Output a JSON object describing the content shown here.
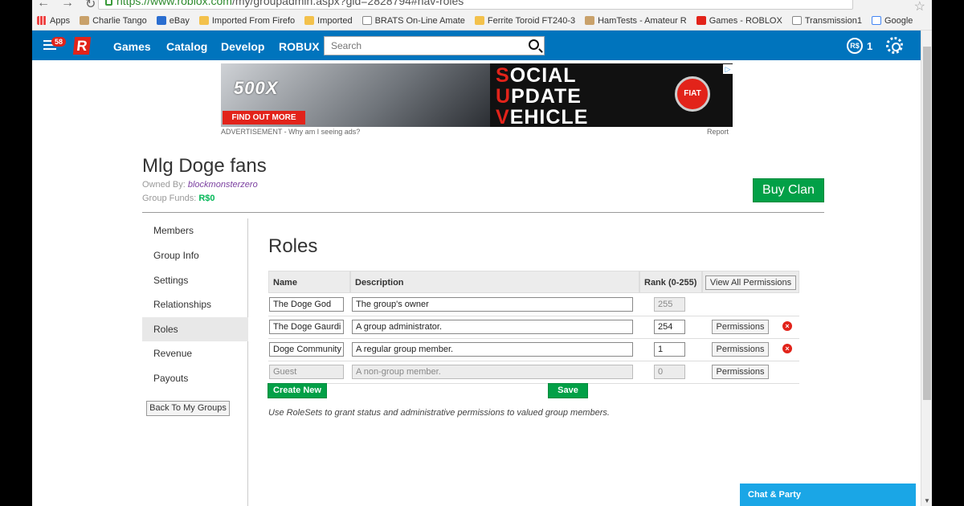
{
  "browser": {
    "url_host": "https://www.roblox.com",
    "url_path": "/my/groupadmin.aspx?gid=2828794#nav-roles",
    "bookmarks": [
      "Apps",
      "Charlie Tango",
      "eBay",
      "Imported From Firefo",
      "Imported",
      "BRATS On-Line Amate",
      "Ferrite Toroid FT240-3",
      "HamTests - Amateur R",
      "Games - ROBLOX",
      "Transmission1",
      "Google"
    ]
  },
  "navbar": {
    "notification_count": "58",
    "logo": "R",
    "links": [
      "Games",
      "Catalog",
      "Develop",
      "ROBUX"
    ],
    "search_placeholder": "Search",
    "robux_symbol": "R$",
    "robux_count": "1"
  },
  "ad": {
    "car_logo": "500X",
    "cta": "FIND OUT MORE",
    "headline_lines": [
      {
        "first": "S",
        "rest": "OCIAL"
      },
      {
        "first": "U",
        "rest": "PDATE"
      },
      {
        "first": "V",
        "rest": "EHICLE"
      }
    ],
    "brand": "FIAT",
    "caption": "ADVERTISEMENT - Why am I seeing ads?",
    "report": "Report"
  },
  "group": {
    "name": "Mlg Doge fans",
    "owned_by_label": "Owned By:",
    "owner": "blockmonsterzero",
    "funds_label": "Group Funds:",
    "funds_value": "R$0",
    "buy_button": "Buy Clan"
  },
  "sidebar": {
    "items": [
      "Members",
      "Group Info",
      "Settings",
      "Relationships",
      "Roles",
      "Revenue",
      "Payouts"
    ],
    "active": "Roles",
    "back_button": "Back To My Groups"
  },
  "roles": {
    "title": "Roles",
    "headers": {
      "name": "Name",
      "description": "Description",
      "rank": "Rank (0-255)",
      "view_all": "View All Permissions"
    },
    "rows": [
      {
        "name": "The Doge God",
        "description": "The group's owner",
        "rank": "255"
      },
      {
        "name": "The Doge Gaurdi",
        "description": "A group administrator.",
        "rank": "254",
        "permissions": "Permissions"
      },
      {
        "name": "Doge Community",
        "description": "A regular group member.",
        "rank": "1",
        "permissions": "Permissions"
      },
      {
        "name": "Guest",
        "description": "A non-group member.",
        "rank": "0",
        "permissions": "Permissions"
      }
    ],
    "create_button": "Create New",
    "save_button": "Save",
    "note": "Use RoleSets to grant status and administrative permissions to valued group members."
  },
  "chat": {
    "label": "Chat & Party"
  }
}
